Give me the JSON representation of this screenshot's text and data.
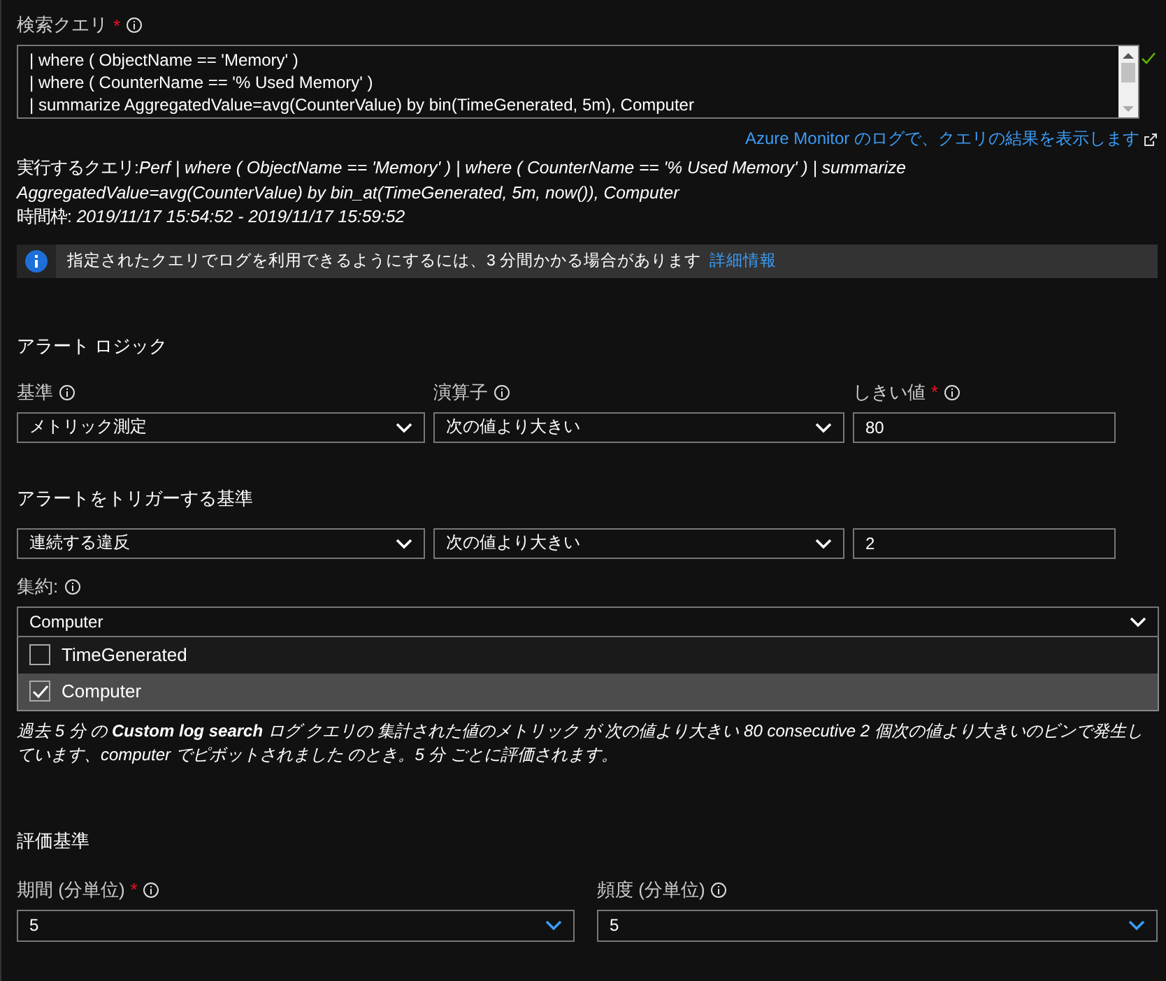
{
  "query": {
    "label": "検索クエリ",
    "required_mark": "*",
    "lines": [
      "| where ( ObjectName == 'Memory' )",
      "| where ( CounterName == '% Used Memory' )",
      "| summarize AggregatedValue=avg(CounterValue) by bin(TimeGenerated, 5m), Computer"
    ],
    "valid": true,
    "link": "Azure Monitor のログで、クエリの結果を表示します"
  },
  "executed": {
    "label": "実行するクエリ:",
    "query": "Perf | where ( ObjectName == 'Memory' ) | where ( CounterName == '% Used Memory' ) | summarize AggregatedValue=avg(CounterValue) by bin_at(TimeGenerated, 5m, now()), Computer",
    "timeframe_label": "時間枠:",
    "timeframe": "2019/11/17 15:54:52 - 2019/11/17 15:59:52"
  },
  "info": {
    "text": "指定されたクエリでログを利用できるようにするには、3 分間かかる場合があります",
    "link": "詳細情報"
  },
  "alert_logic": {
    "title": "アラート ロジック",
    "fields": [
      {
        "label": "基準",
        "kind": "select",
        "value": "メトリック測定"
      },
      {
        "label": "演算子",
        "kind": "select",
        "value": "次の値より大きい"
      },
      {
        "label": "しきい値",
        "required_mark": "*",
        "kind": "input",
        "value": "80"
      }
    ]
  },
  "trigger": {
    "title": "アラートをトリガーする基準",
    "fields": [
      {
        "kind": "select",
        "value": "連続する違反"
      },
      {
        "kind": "select",
        "value": "次の値より大きい"
      },
      {
        "kind": "input",
        "value": "2"
      }
    ]
  },
  "aggregation": {
    "label": "集約:",
    "value": "Computer",
    "options": [
      {
        "label": "TimeGenerated",
        "checked": false,
        "selected": false
      },
      {
        "label": "Computer",
        "checked": true,
        "selected": true
      }
    ]
  },
  "summary": "過去 5 分 の **Custom log search** ログ クエリの 集計された値のメトリック が 次の値より大きい 80 consecutive 2 個次の値より大きいのビンで発生しています、computer でピボットされました のとき。5 分 ごとに評価されます。",
  "evaluation": {
    "title": "評価基準",
    "fields": [
      {
        "label": "期間 (分単位)",
        "required_mark": "*",
        "kind": "combo",
        "value": "5"
      },
      {
        "label": "頻度 (分単位)",
        "kind": "combo",
        "value": "5"
      }
    ]
  }
}
